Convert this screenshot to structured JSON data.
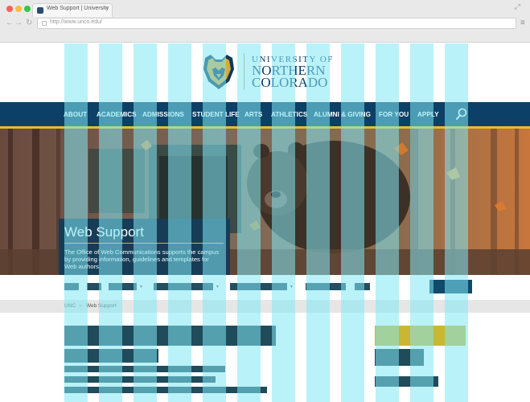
{
  "browser": {
    "tab_title": "Web Support | University",
    "tab_close": "×",
    "url": "http://www.unco.edu/",
    "nav_back": "←",
    "nav_forward": "→",
    "nav_reload": "↻",
    "menu": "≡",
    "expand": "⤢"
  },
  "logo": {
    "line1": "UNIVERSITY OF",
    "line2": "NORTHERN",
    "line3": "COLORADO"
  },
  "nav": {
    "items": [
      "ABOUT",
      "ACADEMICS",
      "ADMISSIONS",
      "STUDENT LIFE",
      "ARTS",
      "ATHLETICS",
      "ALUMNI & GIVING",
      "FOR YOU",
      "APPLY"
    ],
    "search_icon": "search-icon"
  },
  "hero": {
    "title": "Web Support",
    "description": "The Office of Web Communications supports the campus by providing information, guidelines and templates for Web authors."
  },
  "breadcrumb": {
    "home": "UNC",
    "separator": "»",
    "current": "Web Support"
  },
  "colors": {
    "nav_blue": "#0c4066",
    "accent_gold": "#e6bd2f",
    "grid_cyan": "#82e8f5",
    "placeholder_bar": "#1f4b5a",
    "sidebar_yellow": "#c9b733"
  }
}
